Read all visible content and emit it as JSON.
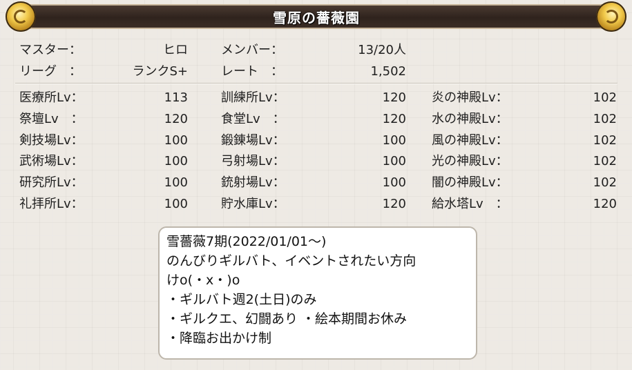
{
  "header": {
    "title": "雪原の薔薇園"
  },
  "guild_info": {
    "master_label": "マスター：",
    "master_value": "ヒロ",
    "member_label": "メンバー：",
    "member_value": "13/20人",
    "league_label": "リーグ　：",
    "league_value": "ランクS+",
    "rate_label": "レート　：",
    "rate_value": "1,502"
  },
  "facilities": {
    "col1": [
      {
        "label": "医療所Lv：",
        "value": "113"
      },
      {
        "label": "祭壇Lv　：",
        "value": "120"
      },
      {
        "label": "剣技場Lv：",
        "value": "100"
      },
      {
        "label": "武術場Lv：",
        "value": "100"
      },
      {
        "label": "研究所Lv：",
        "value": "100"
      },
      {
        "label": "礼拝所Lv：",
        "value": "100"
      }
    ],
    "col2": [
      {
        "label": "訓練所Lv：",
        "value": "120"
      },
      {
        "label": "食堂Lv　：",
        "value": "120"
      },
      {
        "label": "鍛錬場Lv：",
        "value": "100"
      },
      {
        "label": "弓射場Lv：",
        "value": "100"
      },
      {
        "label": "銃射場Lv：",
        "value": "100"
      },
      {
        "label": "貯水庫Lv：",
        "value": "120"
      }
    ],
    "col3": [
      {
        "label": "炎の神殿Lv：",
        "value": "102"
      },
      {
        "label": "水の神殿Lv：",
        "value": "102"
      },
      {
        "label": "風の神殿Lv：",
        "value": "102"
      },
      {
        "label": "光の神殿Lv：",
        "value": "102"
      },
      {
        "label": "闇の神殿Lv：",
        "value": "102"
      },
      {
        "label": "給水塔Lv　：",
        "value": "120"
      }
    ]
  },
  "comment": {
    "lines": [
      "雪薔薇7期(2022/01/01～)",
      "のんびりギルバト、イベントされたい方向",
      "けo(・x・)o",
      "・ギルバト週2(土日)のみ",
      "・ギルクエ、幻闘あり ・絵本期間お休み",
      "・降臨お出かけ制"
    ]
  }
}
